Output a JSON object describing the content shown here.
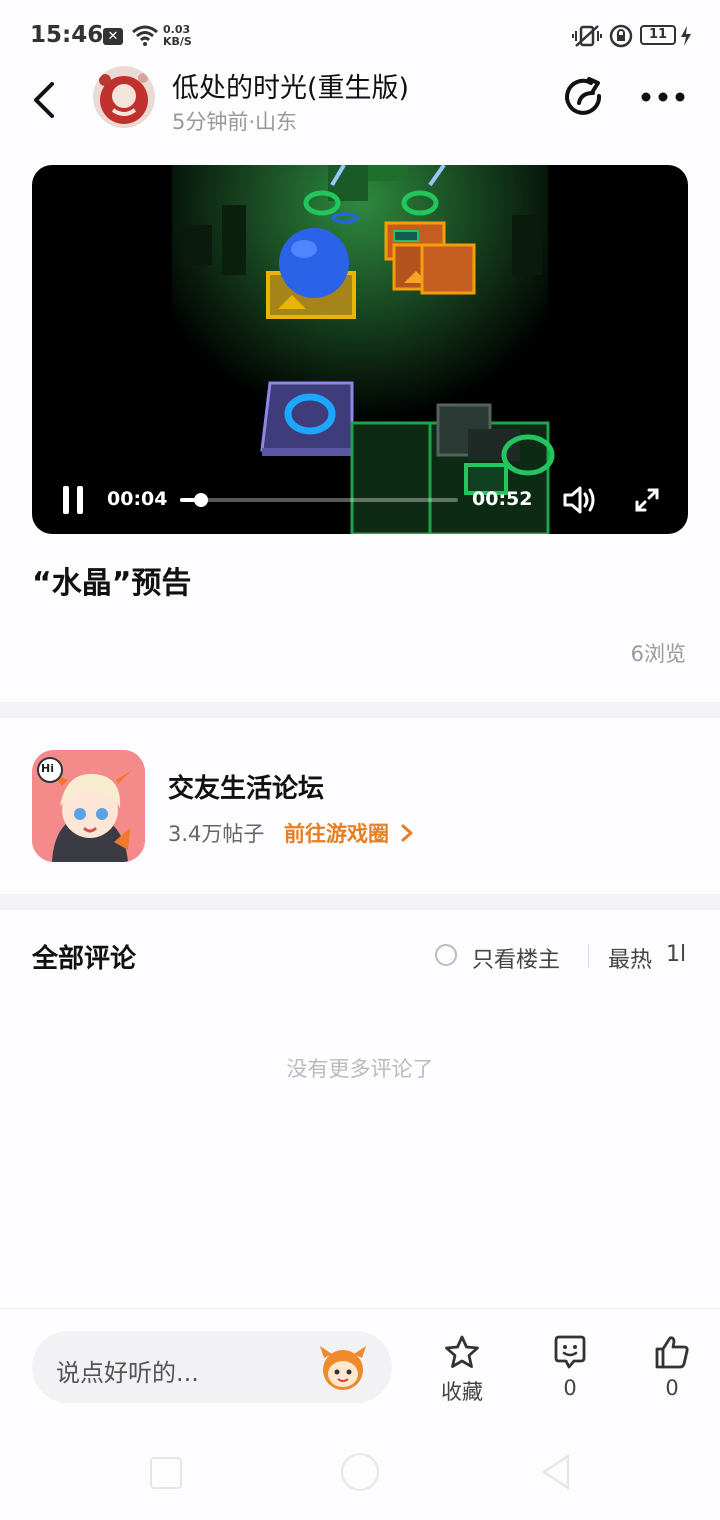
{
  "status_bar": {
    "time": "15:46",
    "net_speed_value": "0.03",
    "net_speed_unit": "KB/S",
    "battery": "11"
  },
  "header": {
    "title": "低处的时光(重生版)",
    "subtitle": "5分钟前·山东"
  },
  "video": {
    "current_time": "00:04",
    "total_time": "00:52",
    "progress": 0.077
  },
  "post": {
    "title": "“水晶”预告",
    "views": "6浏览"
  },
  "forum": {
    "name": "交友生活论坛",
    "posts": "3.4万帖子",
    "link": "前往游戏圈",
    "icon_badge": "Hi"
  },
  "comments": {
    "title": "全部评论",
    "only_op": "只看楼主",
    "sort": "最热",
    "sort_cut": "1l",
    "empty": "没有更多评论了"
  },
  "bottom_bar": {
    "placeholder": "说点好听的...",
    "collect_label": "收藏",
    "comment_count": "0",
    "like_count": "0"
  },
  "colors": {
    "accent": "#e67e22",
    "background": "#fdfcff",
    "divider": "#f3f2f6"
  }
}
